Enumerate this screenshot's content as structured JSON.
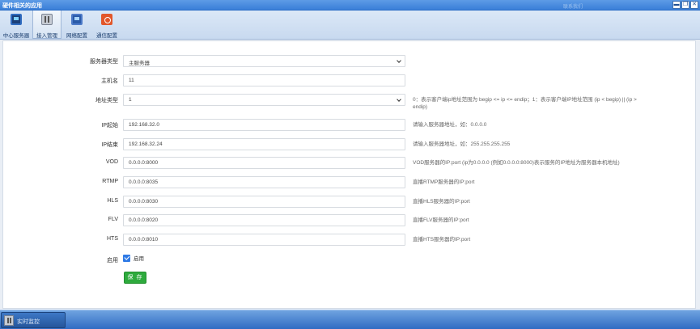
{
  "window": {
    "title": "硬件相关的应用",
    "ghost_text": "联系我们",
    "buttons": [
      "▬",
      "❐",
      "✕"
    ]
  },
  "toolbar": {
    "items": [
      {
        "label": "中心服务器",
        "icon": "server-monitor-icon"
      },
      {
        "label": "接入管理",
        "icon": "access-management-icon",
        "active": true
      },
      {
        "label": "网络配置",
        "icon": "network-monitor-icon"
      },
      {
        "label": "通信配置",
        "icon": "communication-icon"
      }
    ]
  },
  "form": {
    "server_type": {
      "label": "服务器类型",
      "value": "主服务器"
    },
    "hostname": {
      "label": "主机名",
      "value": "11"
    },
    "address_type": {
      "label": "地址类型",
      "value": "1",
      "hint": "0：表示客户端ip地址范围为 begip <= ip <= endip；1：表示客户端IP地址范围 (ip < begip) || (ip > endip)"
    },
    "ip_start": {
      "label": "IP起始",
      "value": "192.168.32.0",
      "hint": "请输入服务器地址，如：0.0.0.0"
    },
    "ip_end": {
      "label": "IP结束",
      "value": "192.168.32.24",
      "hint": "请输入服务器地址，如：255.255.255.255"
    },
    "vod": {
      "label": "VOD",
      "value": "0.0.0.0:8000",
      "hint": "VOD服务器的IP:port (ip为0.0.0.0 (例如0.0.0.0:8000)表示服务的IP地址为服务器本机地址)"
    },
    "rtmp": {
      "label": "RTMP",
      "value": "0.0.0.0:8035",
      "hint": "直播RTMP服务器的IP:port"
    },
    "hls": {
      "label": "HLS",
      "value": "0.0.0.0:8030",
      "hint": "直播HLS服务器的IP:port"
    },
    "flv": {
      "label": "FLV",
      "value": "0.0.0.0:8020",
      "hint": "直播FLV服务器的IP:port"
    },
    "hts": {
      "label": "HTS",
      "value": "0.0.0.0:8010",
      "hint": "直播HTS服务器的IP:port"
    },
    "enable": {
      "label": "启用",
      "checkbox_label": "启用",
      "checked": true
    },
    "save_label": "保 存"
  },
  "taskbar": {
    "task_label": "实时监控"
  },
  "colors": {
    "accent": "#3a7fd8",
    "save_button": "#2eaa3d",
    "checkbox": "#2f7ae5"
  }
}
